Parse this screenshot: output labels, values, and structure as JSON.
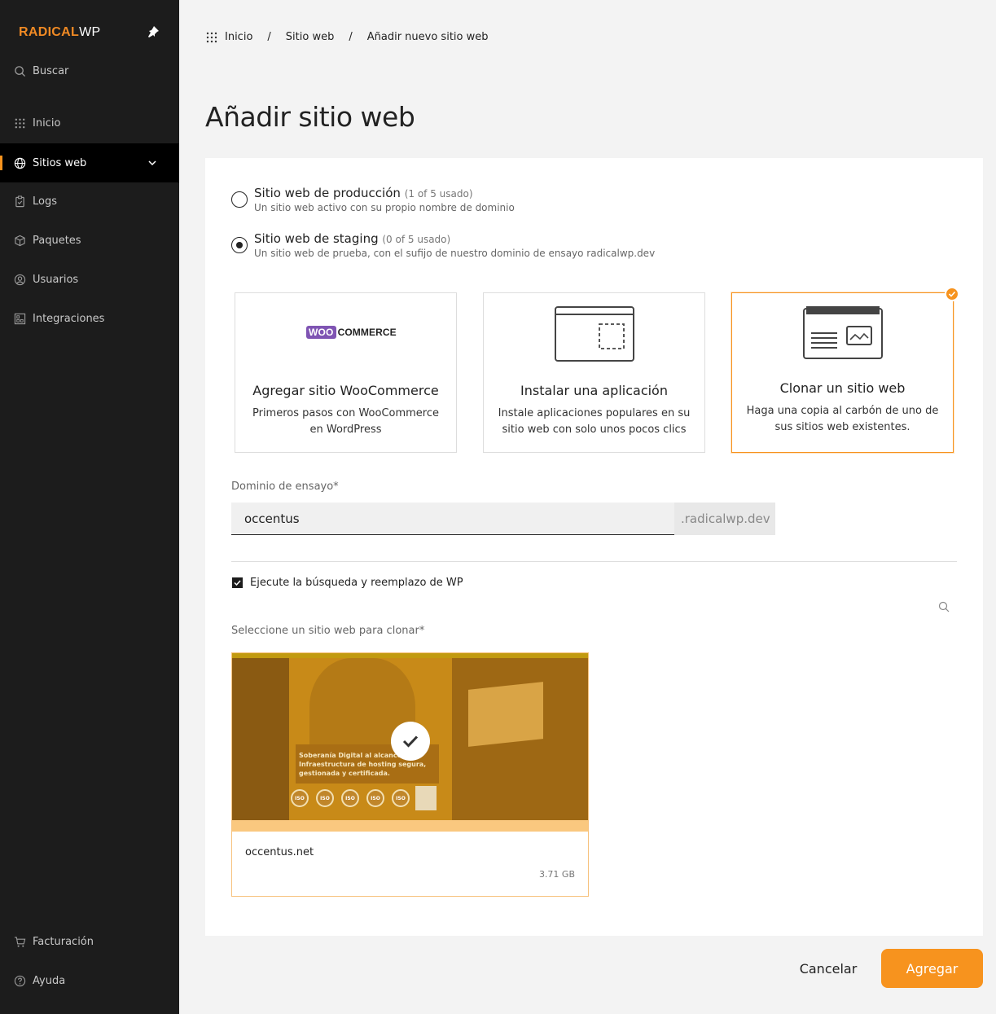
{
  "brand": {
    "part1": "RADICAL",
    "part2": "WP",
    "accent": "#f7931e"
  },
  "sidebar": {
    "search": "Buscar",
    "items": [
      {
        "label": "Inicio",
        "icon": "grid-icon"
      },
      {
        "label": "Sitios web",
        "icon": "globe-icon",
        "active": true
      },
      {
        "label": "Logs",
        "icon": "clipboard-icon"
      },
      {
        "label": "Paquetes",
        "icon": "package-icon"
      },
      {
        "label": "Usuarios",
        "icon": "user-icon"
      },
      {
        "label": "Integraciones",
        "icon": "integrations-icon"
      }
    ],
    "bottom": [
      {
        "label": "Facturación",
        "icon": "cart-icon"
      },
      {
        "label": "Ayuda",
        "icon": "help-icon"
      }
    ]
  },
  "breadcrumb": [
    "Inicio",
    "Sitio web",
    "Añadir nuevo sitio web"
  ],
  "page": {
    "title": "Añadir sitio web"
  },
  "site_type": {
    "production": {
      "title": "Sitio web de producción",
      "usage": "(1 of 5 usado)",
      "desc": "Un sitio web activo con su propio nombre de dominio",
      "selected": false
    },
    "staging": {
      "title": "Sitio web de staging",
      "usage": "(0 of 5 usado)",
      "desc": "Un sitio web de prueba, con el sufijo de nuestro dominio de ensayo radicalwp.dev",
      "selected": true
    }
  },
  "options": [
    {
      "title": "Agregar sitio WooCommerce",
      "desc": "Primeros pasos con WooCommerce en WordPress",
      "logo_box": "WOO",
      "logo_text": "COMMERCE"
    },
    {
      "title": "Instalar una aplicación",
      "desc": "Instale aplicaciones populares en su sitio web con solo unos pocos clics"
    },
    {
      "title": "Clonar un sitio web",
      "desc": "Haga una copia al carbón de uno de sus sitios web existentes.",
      "selected": true
    }
  ],
  "domain": {
    "label": "Dominio de ensayo*",
    "value": "occentus",
    "suffix": ".radicalwp.dev"
  },
  "search_replace": {
    "label": "Ejecute la búsqueda y reemplazo de WP",
    "checked": true
  },
  "clone": {
    "label": "Seleccione un sitio web para clonar*",
    "site": {
      "name": "occentus.net",
      "size": "3.71 GB",
      "thumb_text": "Soberanía Digital al alcance. Infraestructura de hosting segura, gestionada y certificada.",
      "iso_label": "ISO"
    }
  },
  "actions": {
    "cancel": "Cancelar",
    "add": "Agregar"
  }
}
